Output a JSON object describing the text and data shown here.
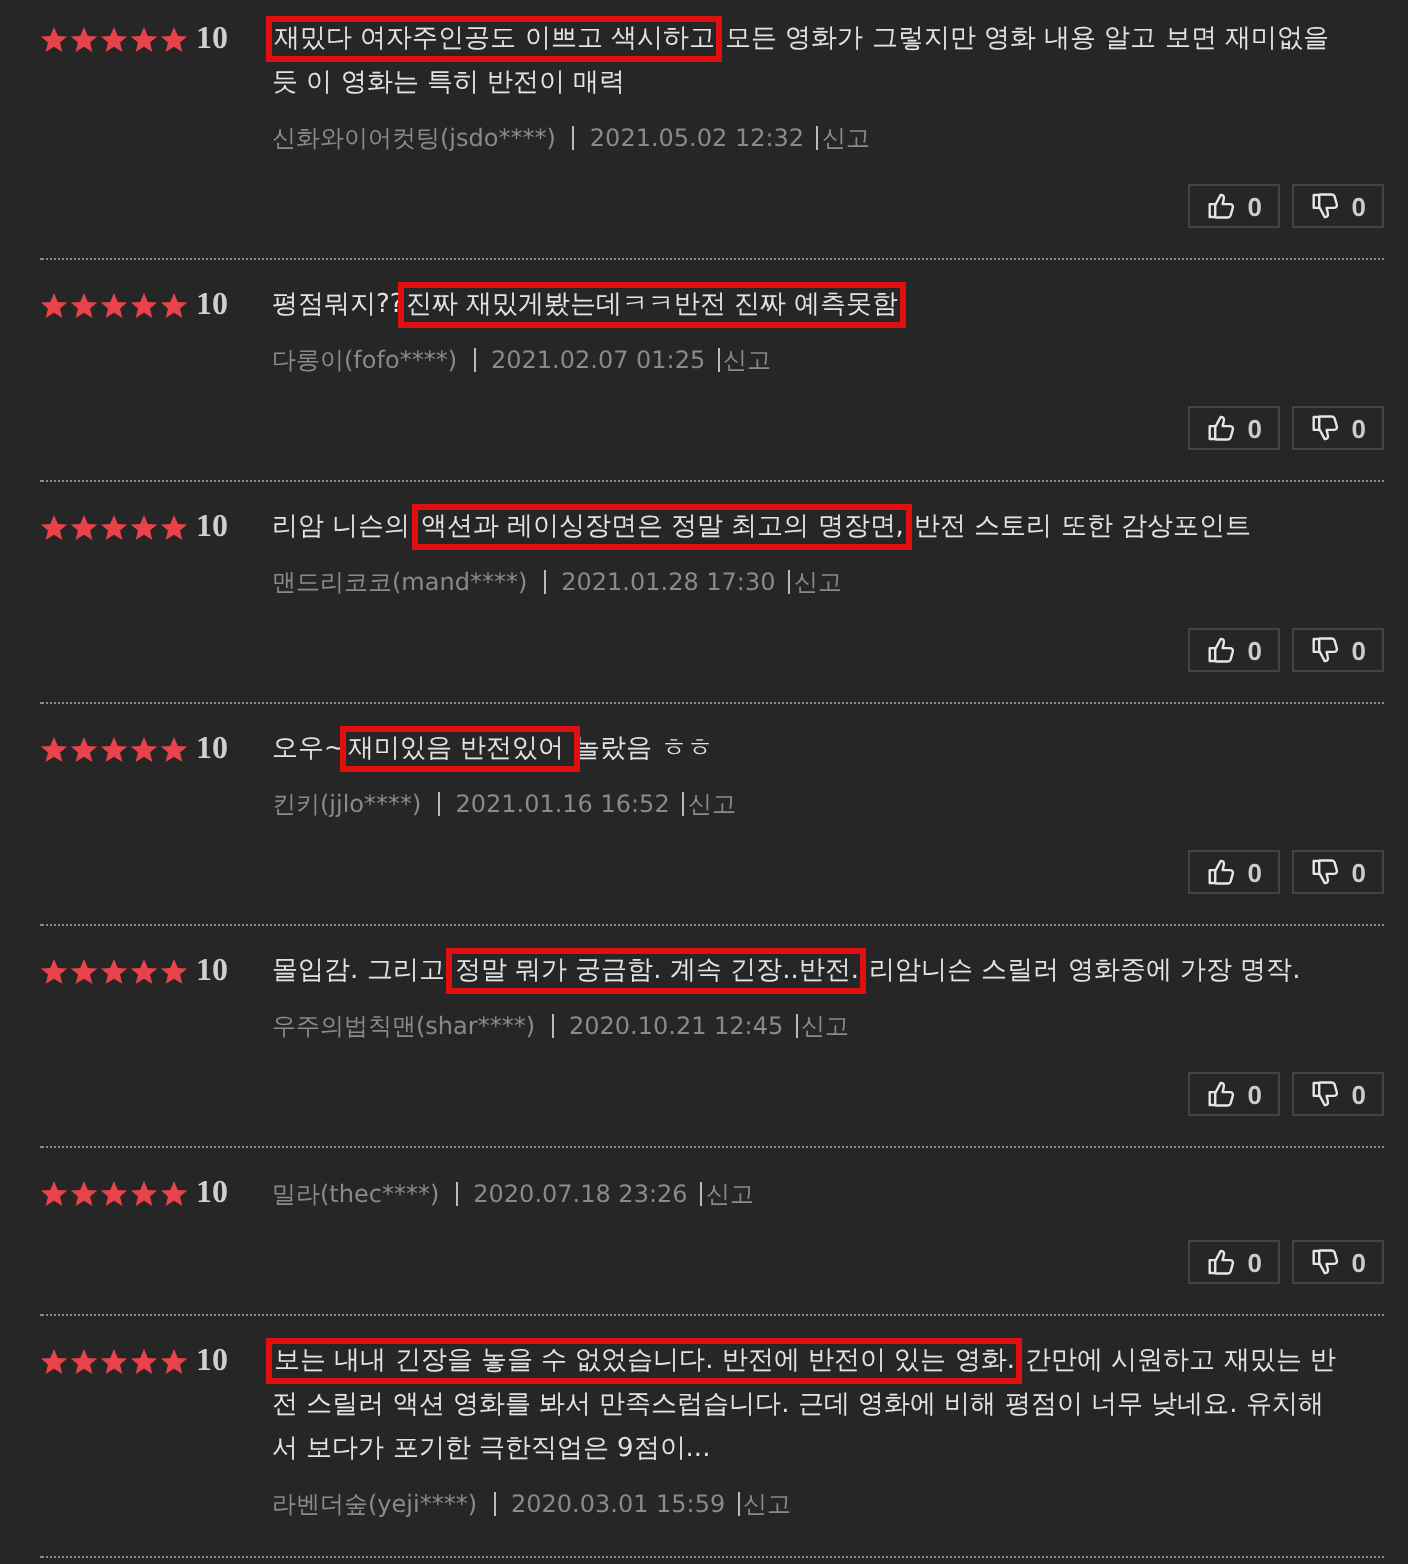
{
  "reviews": [
    {
      "stars": 5,
      "score": "10",
      "segments": [
        {
          "text": "재밌다 여자주인공도 이쁘고 색시하고",
          "highlighted": true
        },
        {
          "text": " 모든 영화가 그렇지만 영화 내용 알고 보면 재미없을 듯 이 영화는 특히 반전이 매력",
          "highlighted": false
        }
      ],
      "author": "신화와이어컷팅(jsdo****)",
      "date": "2021.05.02 12:32",
      "report": "신고",
      "likes": "0",
      "dislikes": "0"
    },
    {
      "stars": 5,
      "score": "10",
      "segments": [
        {
          "text": "평점뭐지??",
          "highlighted": false
        },
        {
          "text": "진짜 재밌게봤는데ㅋㅋ반전 진짜 예측못함",
          "highlighted": true
        }
      ],
      "author": "다롱이(fofo****)",
      "date": "2021.02.07 01:25",
      "report": "신고",
      "likes": "0",
      "dislikes": "0"
    },
    {
      "stars": 5,
      "score": "10",
      "segments": [
        {
          "text": "리암 니슨의 ",
          "highlighted": false
        },
        {
          "text": "액션과 레이싱장면은 정말 최고의 명장면,",
          "highlighted": true
        },
        {
          "text": " 반전 스토리 또한 감상포인트",
          "highlighted": false
        }
      ],
      "author": "맨드리코코(mand****)",
      "date": "2021.01.28 17:30",
      "report": "신고",
      "likes": "0",
      "dislikes": "0"
    },
    {
      "stars": 5,
      "score": "10",
      "segments": [
        {
          "text": "오우~",
          "highlighted": false
        },
        {
          "text": "재미있음 반전있어 ",
          "highlighted": true
        },
        {
          "text": "놀랐음 ㅎㅎ",
          "highlighted": false
        }
      ],
      "author": "킨키(jjlo****)",
      "date": "2021.01.16 16:52",
      "report": "신고",
      "likes": "0",
      "dislikes": "0"
    },
    {
      "stars": 5,
      "score": "10",
      "segments": [
        {
          "text": "몰입감. 그리고 ",
          "highlighted": false
        },
        {
          "text": "정말 뭐가 궁금함. 계속 긴장..반전.",
          "highlighted": true
        },
        {
          "text": " 리암니슨 스릴러 영화중에 가장 명작.",
          "highlighted": false
        }
      ],
      "author": "우주의법칙맨(shar****)",
      "date": "2020.10.21 12:45",
      "report": "신고",
      "likes": "0",
      "dislikes": "0"
    },
    {
      "stars": 5,
      "score": "10",
      "author": "밀라(thec****)",
      "date": "2020.07.18 23:26",
      "report": "신고",
      "likes": "0",
      "dislikes": "0"
    },
    {
      "stars": 5,
      "score": "10",
      "segments": [
        {
          "text": "보는 내내 긴장을 놓을 수 없었습니다. 반전에 반전이 있는 영화.",
          "highlighted": true
        },
        {
          "text": " 간만에 시원하고 재밌는 반전 스릴러 액션 영화를 봐서 만족스럽습니다. 근데 영화에 비해 평점이 너무 낮네요. 유치해서 보다가 포기한 극한직업은 9점이...",
          "highlighted": false
        }
      ],
      "author": "라벤더숲(yeji****)",
      "date": "2020.03.01 15:59",
      "report": "신고"
    }
  ]
}
